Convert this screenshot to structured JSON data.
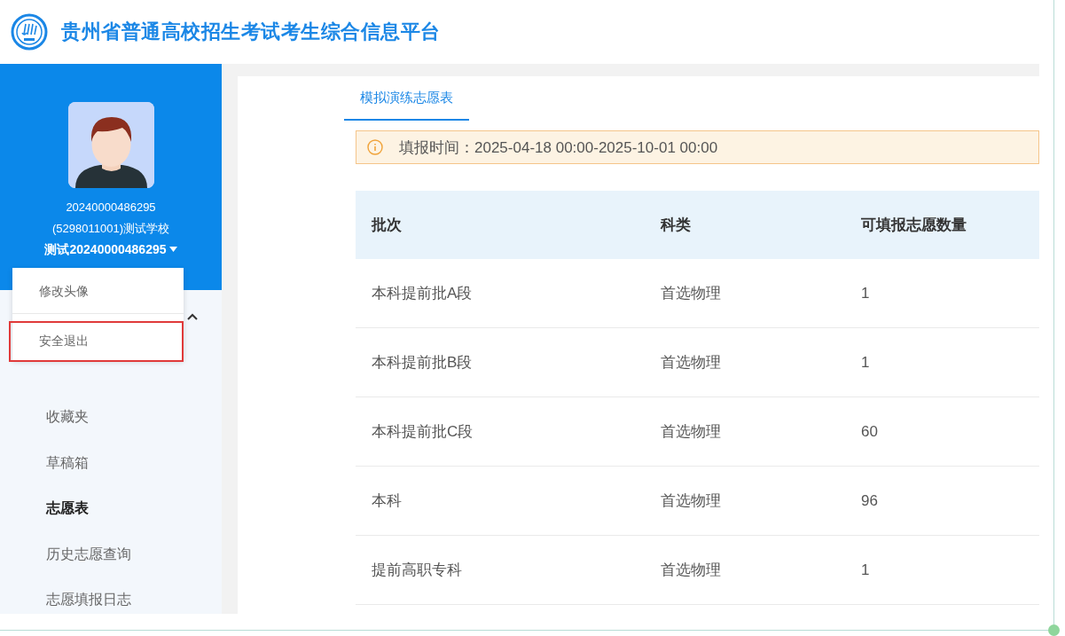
{
  "header": {
    "title": "贵州省普通高校招生考试考生综合信息平台"
  },
  "profile": {
    "exam_number": "20240000486295",
    "school": "(5298011001)测试学校",
    "name": "测试20240000486295",
    "menu_open": true
  },
  "user_menu": [
    {
      "label": "修改头像",
      "highlighted": false
    },
    {
      "label": "安全退出",
      "highlighted": true
    }
  ],
  "sidebar": {
    "group_expanded": true,
    "items": [
      {
        "label": "收藏夹",
        "selected": false
      },
      {
        "label": "草稿箱",
        "selected": false
      },
      {
        "label": "志愿表",
        "selected": true
      },
      {
        "label": "历史志愿查询",
        "selected": false
      },
      {
        "label": "志愿填报日志",
        "selected": false
      }
    ]
  },
  "tabs": [
    {
      "label": "模拟演练志愿表",
      "selected": true
    }
  ],
  "notice": "填报时间：2025-04-18 00:00-2025-10-01 00:00",
  "table": {
    "columns": [
      "批次",
      "科类",
      "可填报志愿数量"
    ],
    "rows": [
      [
        "本科提前批A段",
        "首选物理",
        "1"
      ],
      [
        "本科提前批B段",
        "首选物理",
        "1"
      ],
      [
        "本科提前批C段",
        "首选物理",
        "60"
      ],
      [
        "本科",
        "首选物理",
        "96"
      ],
      [
        "提前高职专科",
        "首选物理",
        "1"
      ]
    ]
  }
}
